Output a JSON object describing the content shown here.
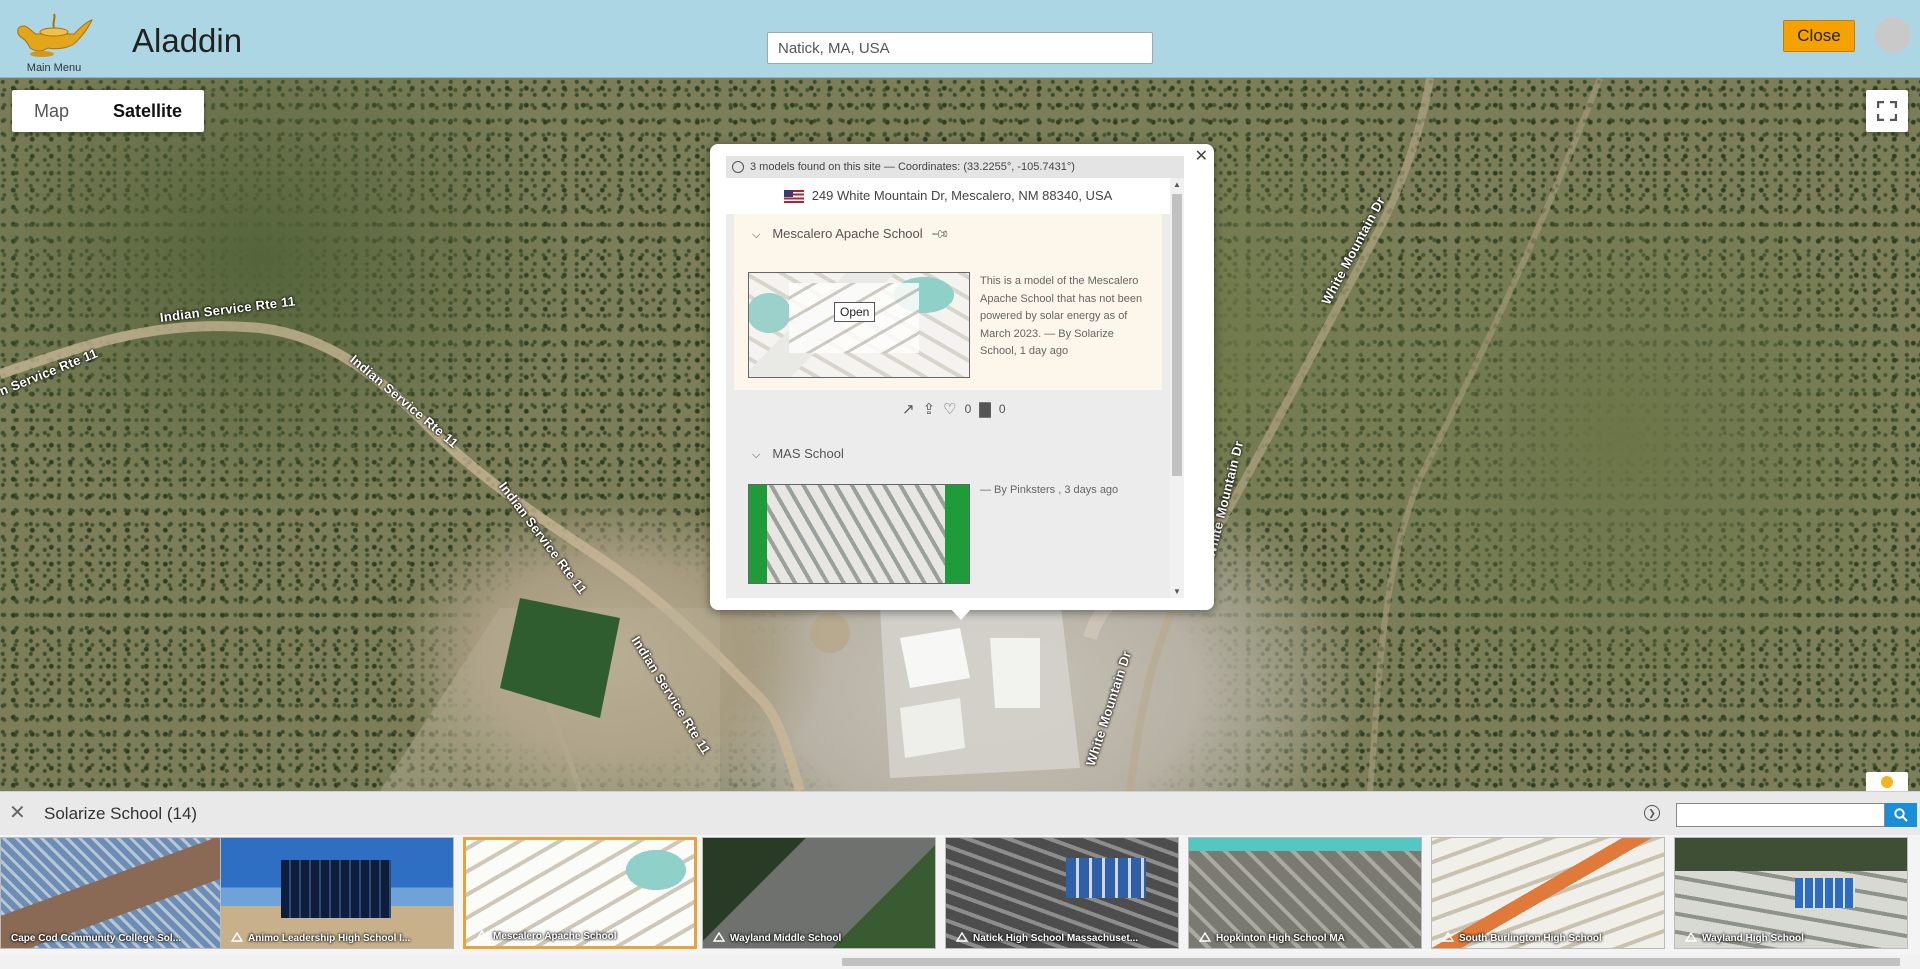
{
  "header": {
    "main_menu_label": "Main Menu",
    "title": "Aladdin",
    "search_value": "Natick, MA, USA",
    "close_label": "Close"
  },
  "map": {
    "types": [
      "Map",
      "Satellite"
    ],
    "active_type": "Satellite",
    "labels": {
      "indian1": "Indian Service Rte 11",
      "indian2": "Indian Service Rte 11",
      "indian3": "Indian Service Rte 11",
      "indian4": "Indian Service Rte 11",
      "indian5": "n Service Rte 11",
      "white1": "White Mountain Dr",
      "white2": "White Mountain Dr",
      "white3": "White Mountain Dr"
    }
  },
  "popup": {
    "header": "3 models found on this site — Coordinates: (33.2255°, -105.7431°)",
    "address": "249 White Mountain Dr, Mescalero, NM 88340, USA",
    "model1": {
      "title": "Mescalero Apache School",
      "description": "This is a model of the Mescalero Apache School that has not been powered by solar energy as of March 2023. — By Solarize School, 1 day ago",
      "open_label": "Open",
      "likes": "0",
      "views": "0"
    },
    "model2": {
      "title": "MAS School",
      "description": "— By Pinksters , 3 days ago"
    }
  },
  "collection": {
    "title": "Solarize School (14)",
    "tiles": [
      "Cape Cod Community College Sol...",
      "Animo Leadership High School I...",
      "Mescalero Apache School",
      "Wayland Middle School",
      "Natick High School Massachuset...",
      "Hopkinton High School MA",
      "South Burlington High School",
      "Wayland High School"
    ]
  }
}
